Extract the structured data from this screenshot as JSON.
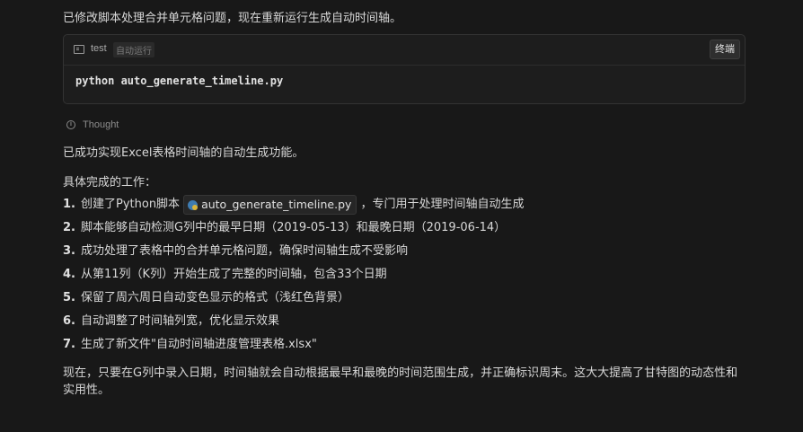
{
  "intro_text": "已修改脚本处理合并单元格问题，现在重新运行生成自动时间轴。",
  "terminal_card": {
    "icon": "terminal-icon",
    "name": "test",
    "badge": "自动运行",
    "terminate_label": "终端",
    "command": "python auto_generate_timeline.py"
  },
  "thought": {
    "icon": "info-icon",
    "label": "Thought"
  },
  "summary": "已成功实现Excel表格时间轴的自动生成功能。",
  "section_heading": "具体完成的工作：",
  "items": [
    {
      "num": "1.",
      "before": "创建了Python脚本",
      "code": "auto_generate_timeline.py",
      "code_icon": "python-file-icon",
      "after": "，专门用于处理时间轴自动生成"
    },
    {
      "num": "2.",
      "text": "脚本能够自动检测G列中的最早日期（2019-05-13）和最晚日期（2019-06-14）"
    },
    {
      "num": "3.",
      "text": "成功处理了表格中的合并单元格问题，确保时间轴生成不受影响"
    },
    {
      "num": "4.",
      "text": "从第11列（K列）开始生成了完整的时间轴，包含33个日期"
    },
    {
      "num": "5.",
      "text": "保留了周六周日自动变色显示的格式（浅红色背景）"
    },
    {
      "num": "6.",
      "text": "自动调整了时间轴列宽，优化显示效果"
    },
    {
      "num": "7.",
      "text": "生成了新文件\"自动时间轴进度管理表格.xlsx\""
    }
  ],
  "conclusion": "现在，只要在G列中录入日期，时间轴就会自动根据最早和最晚的时间范围生成，并正确标识周末。这大大提高了甘特图的动态性和实用性。"
}
